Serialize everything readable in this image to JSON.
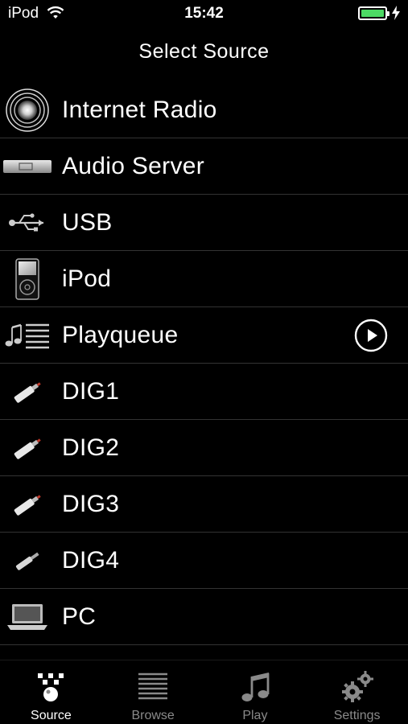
{
  "status_bar": {
    "carrier": "iPod",
    "time": "15:42",
    "battery_level": 1.0,
    "battery_color": "#4cd964"
  },
  "nav": {
    "title": "Select Source"
  },
  "sources": [
    {
      "label": "Internet Radio",
      "icon": "radio-waves-icon"
    },
    {
      "label": "Audio Server",
      "icon": "server-icon"
    },
    {
      "label": "USB",
      "icon": "usb-icon"
    },
    {
      "label": "iPod",
      "icon": "ipod-icon"
    },
    {
      "label": "Playqueue",
      "icon": "playqueue-icon",
      "action_icon": "play-circle-icon"
    },
    {
      "label": "DIG1",
      "icon": "digital-plug-icon"
    },
    {
      "label": "DIG2",
      "icon": "digital-plug-icon"
    },
    {
      "label": "DIG3",
      "icon": "digital-plug-icon"
    },
    {
      "label": "DIG4",
      "icon": "digital-plug-icon"
    },
    {
      "label": "PC",
      "icon": "laptop-icon"
    }
  ],
  "tab_bar": {
    "tabs": [
      {
        "label": "Source",
        "icon": "source-icon",
        "active": true
      },
      {
        "label": "Browse",
        "icon": "list-icon",
        "active": false
      },
      {
        "label": "Play",
        "icon": "music-note-icon",
        "active": false
      },
      {
        "label": "Settings",
        "icon": "gears-icon",
        "active": false
      }
    ]
  }
}
